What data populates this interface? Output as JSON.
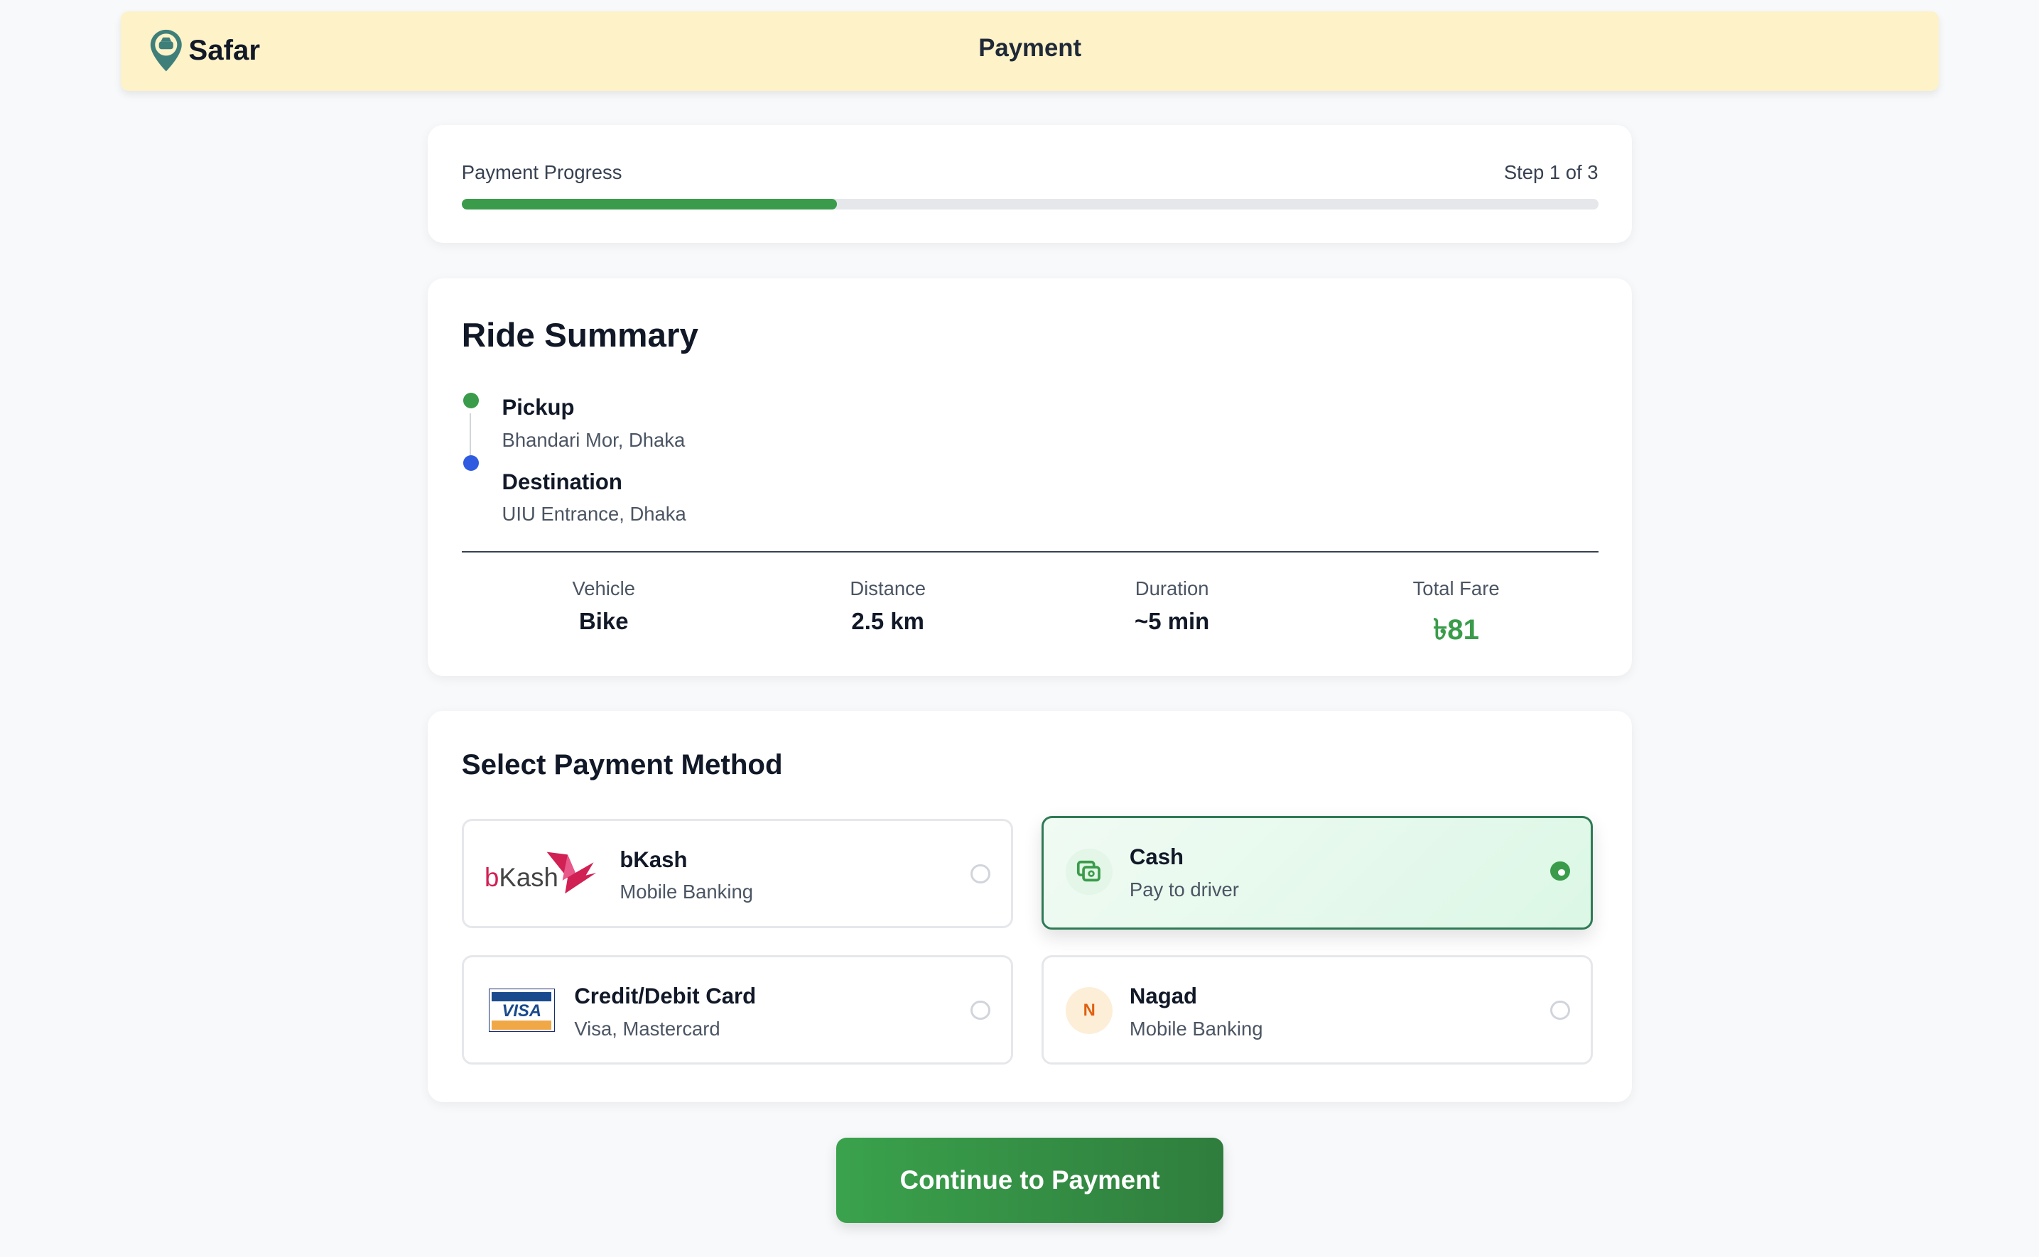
{
  "header": {
    "brand": "Safar",
    "title": "Payment"
  },
  "progress": {
    "label": "Payment Progress",
    "step": "Step 1 of 3",
    "percent": 33,
    "color": "#3a9c4b"
  },
  "summary": {
    "title": "Ride Summary",
    "pickup": {
      "label": "Pickup",
      "value": "Bhandari Mor, Dhaka",
      "color": "#3a9c4b"
    },
    "destination": {
      "label": "Destination",
      "value": "UIU Entrance, Dhaka",
      "color": "#2f5be0"
    },
    "stats": [
      {
        "label": "Vehicle",
        "value": "Bike"
      },
      {
        "label": "Distance",
        "value": "2.5 km"
      },
      {
        "label": "Duration",
        "value": "~5 min"
      },
      {
        "label": "Total Fare",
        "value": "৳81"
      }
    ]
  },
  "payment": {
    "title": "Select Payment Method",
    "selected": "Cash",
    "options": [
      {
        "title": "bKash",
        "subtitle": "Mobile Banking",
        "logo": "bKash"
      },
      {
        "title": "Cash",
        "subtitle": "Pay to driver",
        "icon": "cash-icon"
      },
      {
        "title": "Credit/Debit Card",
        "subtitle": "Visa, Mastercard",
        "logo": "VISA"
      },
      {
        "title": "Nagad",
        "subtitle": "Mobile Banking",
        "icon_letter": "N"
      }
    ]
  },
  "continue_label": "Continue to Payment"
}
